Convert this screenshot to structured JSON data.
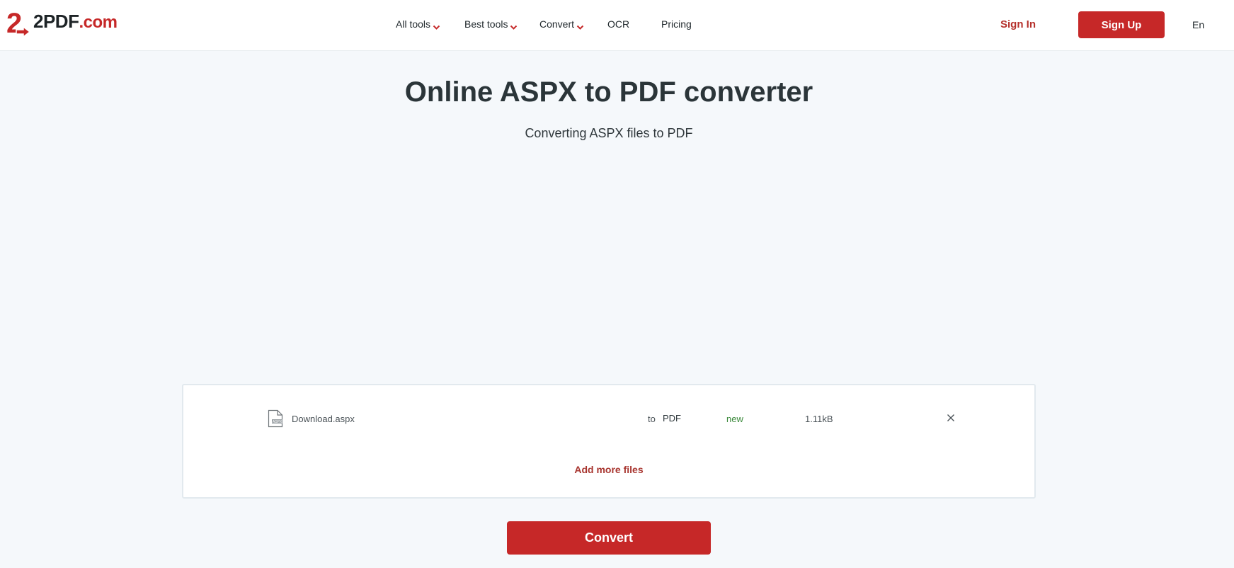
{
  "brand": {
    "logo_main": "2PDF",
    "logo_suffix": ".com",
    "accent_color": "#c62828"
  },
  "nav": {
    "items": [
      {
        "label": "All tools",
        "has_dropdown": true,
        "icon": "chevron-down-icon"
      },
      {
        "label": "Best tools",
        "has_dropdown": true,
        "icon": "chevron-down-icon"
      },
      {
        "label": "Convert",
        "has_dropdown": true,
        "icon": "chevron-down-icon"
      },
      {
        "label": "OCR",
        "has_dropdown": false
      },
      {
        "label": "Pricing",
        "has_dropdown": false
      }
    ],
    "sign_in": "Sign In",
    "sign_up": "Sign Up",
    "language": "En"
  },
  "hero": {
    "title": "Online ASPX to PDF converter",
    "subtitle": "Converting ASPX files to PDF"
  },
  "files": {
    "rows": [
      {
        "icon": "aspx-file-icon",
        "name": "Download.aspx",
        "to_label": "to",
        "target_format": "PDF",
        "status": "new",
        "size": "1.11kB",
        "remove_icon": "close-icon"
      }
    ],
    "add_more_label": "Add more files"
  },
  "actions": {
    "convert_label": "Convert"
  }
}
